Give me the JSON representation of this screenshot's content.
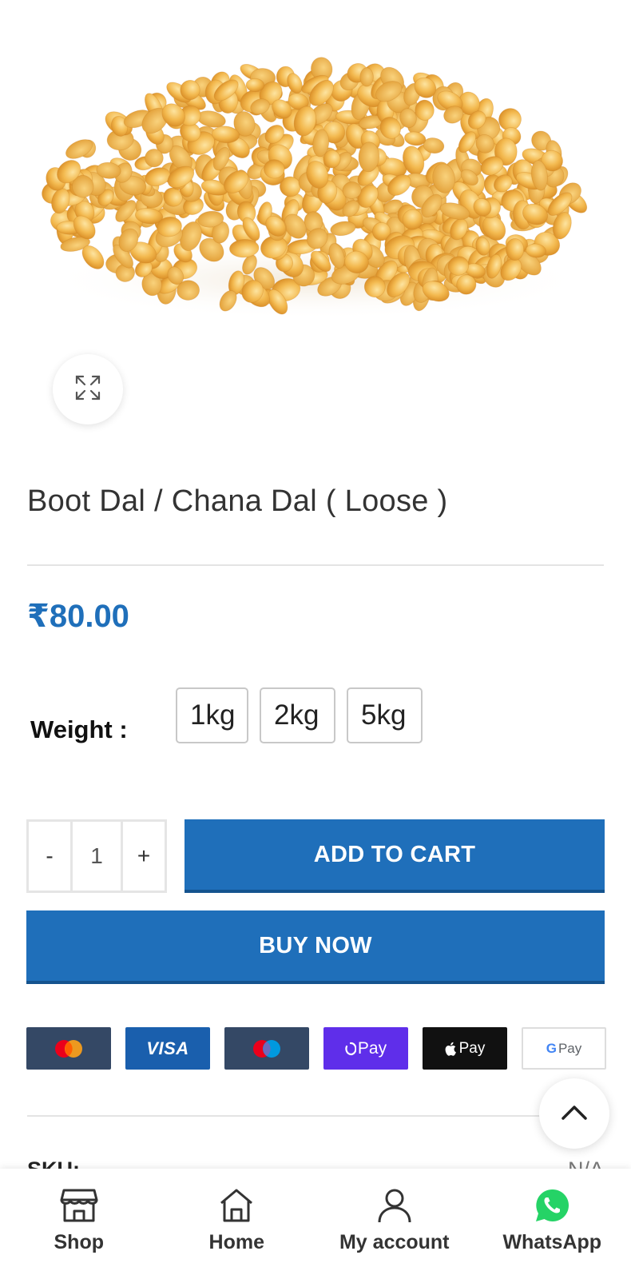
{
  "product": {
    "title": "Boot Dal / Chana Dal ( Loose )",
    "price": "₹80.00"
  },
  "weight": {
    "label": "Weight :",
    "options": [
      "1kg",
      "2kg",
      "5kg"
    ]
  },
  "quantity": {
    "minus": "-",
    "value": "1",
    "plus": "+"
  },
  "actions": {
    "add_to_cart": "ADD TO CART",
    "buy_now": "BUY NOW"
  },
  "payments": {
    "visa": "VISA",
    "opay": "Pay",
    "apay": "Pay",
    "gpay_g": "G",
    "gpay": "Pay"
  },
  "meta": {
    "sku_label": "SKU:",
    "sku_value": "N/A"
  },
  "nav": {
    "shop": "Shop",
    "home": "Home",
    "account": "My account",
    "whatsapp": "WhatsApp"
  },
  "colors": {
    "accent": "#1f6fba",
    "whatsapp": "#25d366"
  }
}
